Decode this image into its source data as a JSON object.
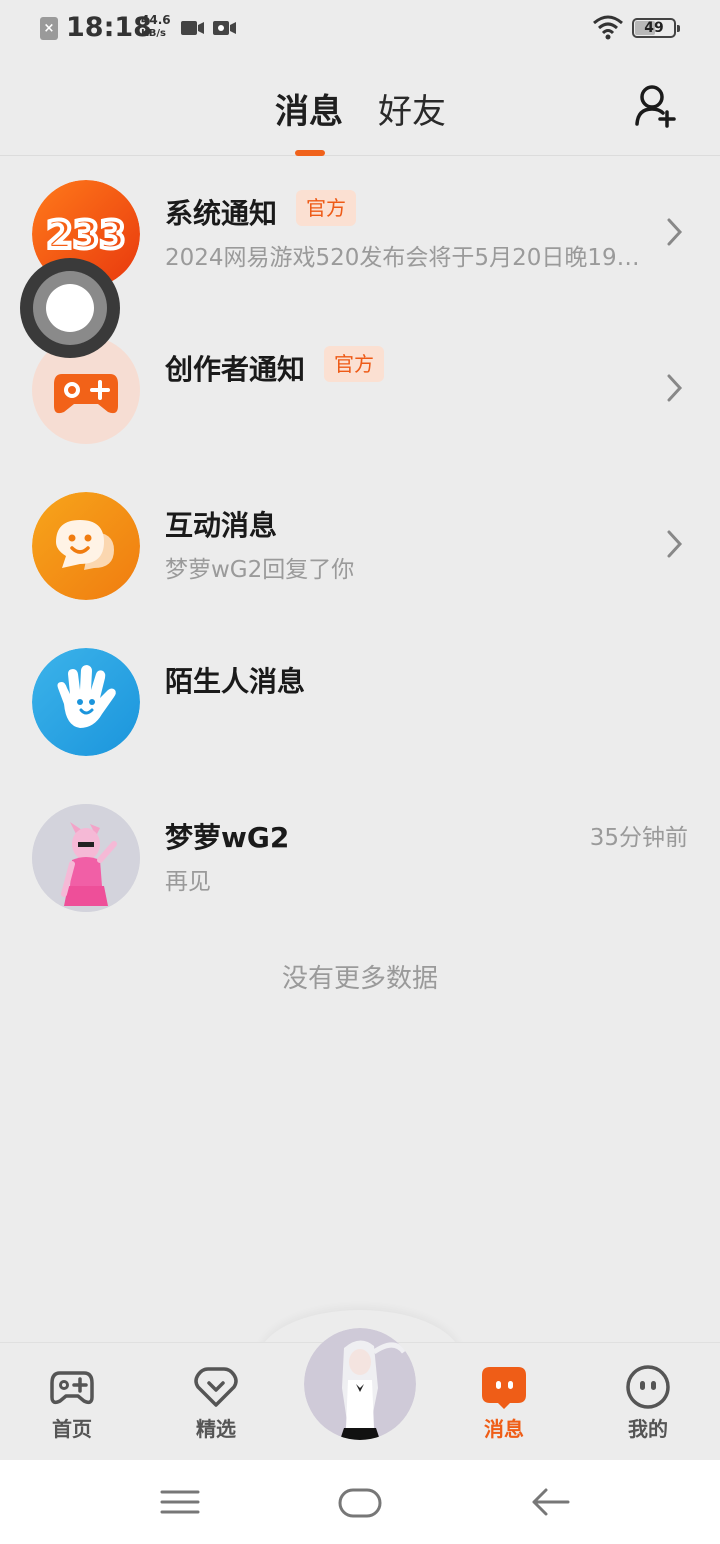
{
  "status_bar": {
    "time": "18:18",
    "net_speed_value": "44.6",
    "net_speed_unit": "KB/s",
    "battery_level": "49"
  },
  "header": {
    "tabs": [
      {
        "label": "消息",
        "active": true
      },
      {
        "label": "好友",
        "active": false
      }
    ],
    "add_friend_icon": "add-user-icon"
  },
  "messages": [
    {
      "title": "系统通知",
      "badge": "官方",
      "subtitle": "2024网易游戏520发布会将于5月20日晚19:3...",
      "icon": "233-logo",
      "has_chevron": true
    },
    {
      "title": "创作者通知",
      "badge": "官方",
      "subtitle": "",
      "icon": "gamepad-icon",
      "has_chevron": true
    },
    {
      "title": "互动消息",
      "subtitle": "梦萝wG2回复了你",
      "icon": "chat-bubble-icon",
      "has_chevron": true
    },
    {
      "title": "陌生人消息",
      "subtitle": "",
      "icon": "wave-hand-icon",
      "has_chevron": false
    },
    {
      "title": "梦萝wG2",
      "subtitle": "再见",
      "time": "35分钟前",
      "icon": "user-avatar",
      "has_chevron": false
    }
  ],
  "footer_text": "没有更多数据",
  "bottom_nav": [
    {
      "label": "首页",
      "icon": "gamepad-icon",
      "active": false
    },
    {
      "label": "精选",
      "icon": "heart-icon",
      "active": false
    },
    {
      "label": "消息",
      "icon": "message-icon",
      "active": true
    },
    {
      "label": "我的",
      "icon": "face-icon",
      "active": false
    }
  ],
  "colors": {
    "accent": "#f0621b",
    "background": "#ececec",
    "badge_bg": "#fbe0d2"
  }
}
